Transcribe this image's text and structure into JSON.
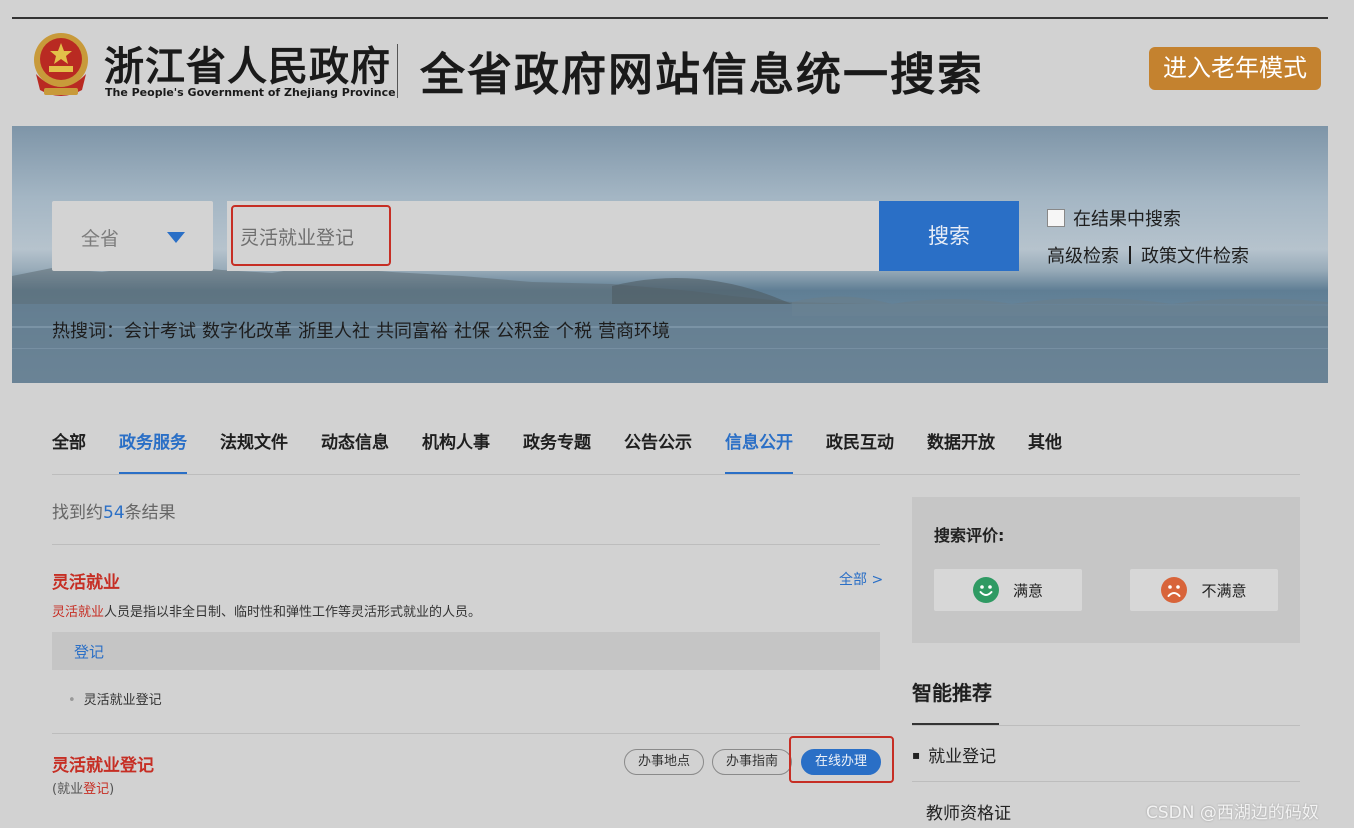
{
  "header": {
    "gov_name_cn": "浙江省人民政府",
    "gov_name_en": "The People's Government of Zhejiang Province",
    "site_title": "全省政府网站信息统一搜索",
    "elder_mode_label": "进入老年模式"
  },
  "search": {
    "scope_value": "全省",
    "query_value": "灵活就业登记",
    "button_label": "搜索",
    "in_results_label": "在结果中搜索",
    "advanced_label": "高级检索",
    "policy_label": "政策文件检索",
    "hot_label": "热搜词：",
    "hot_words": [
      "会计考试",
      "数字化改革",
      "浙里人社",
      "共同富裕",
      "社保",
      "公积金",
      "个税",
      "营商环境"
    ]
  },
  "tabs": [
    {
      "label": "全部",
      "active": false
    },
    {
      "label": "政务服务",
      "active": true
    },
    {
      "label": "法规文件",
      "active": false
    },
    {
      "label": "动态信息",
      "active": false
    },
    {
      "label": "机构人事",
      "active": false
    },
    {
      "label": "政务专题",
      "active": false
    },
    {
      "label": "公告公示",
      "active": false
    },
    {
      "label": "信息公开",
      "active": true
    },
    {
      "label": "政民互动",
      "active": false
    },
    {
      "label": "数据开放",
      "active": false
    },
    {
      "label": "其他",
      "active": false
    }
  ],
  "results": {
    "count_prefix": "找到约",
    "count": "54",
    "count_suffix": "条结果",
    "result1": {
      "title": "灵活就业",
      "all_link": "全部 >",
      "desc_highlight": "灵活就业",
      "desc_rest": "人员是指以非全日制、临时性和弹性工作等灵活形式就业的人员。",
      "bar_label": "登记",
      "sub_item": "灵活就业登记"
    },
    "result2": {
      "title": "灵活就业登记",
      "sub_open": "(就业",
      "sub_highlight": "登记",
      "sub_close": ")",
      "btn_location": "办事地点",
      "btn_guide": "办事指南",
      "btn_online": "在线办理"
    }
  },
  "sidebar": {
    "eval_title": "搜索评价:",
    "satisfied": "满意",
    "unsatisfied": "不满意",
    "rec_title": "智能推荐",
    "rec_items": [
      "就业登记",
      "教师资格证"
    ]
  },
  "watermark": "CSDN @西湖边的码奴",
  "colors": {
    "accent_blue": "#2a6fc6",
    "highlight_red": "#c62e24",
    "elder_orange": "#c4822f",
    "satisfied_green": "#2f9a63",
    "unsatisfied_orange": "#d8643a"
  }
}
